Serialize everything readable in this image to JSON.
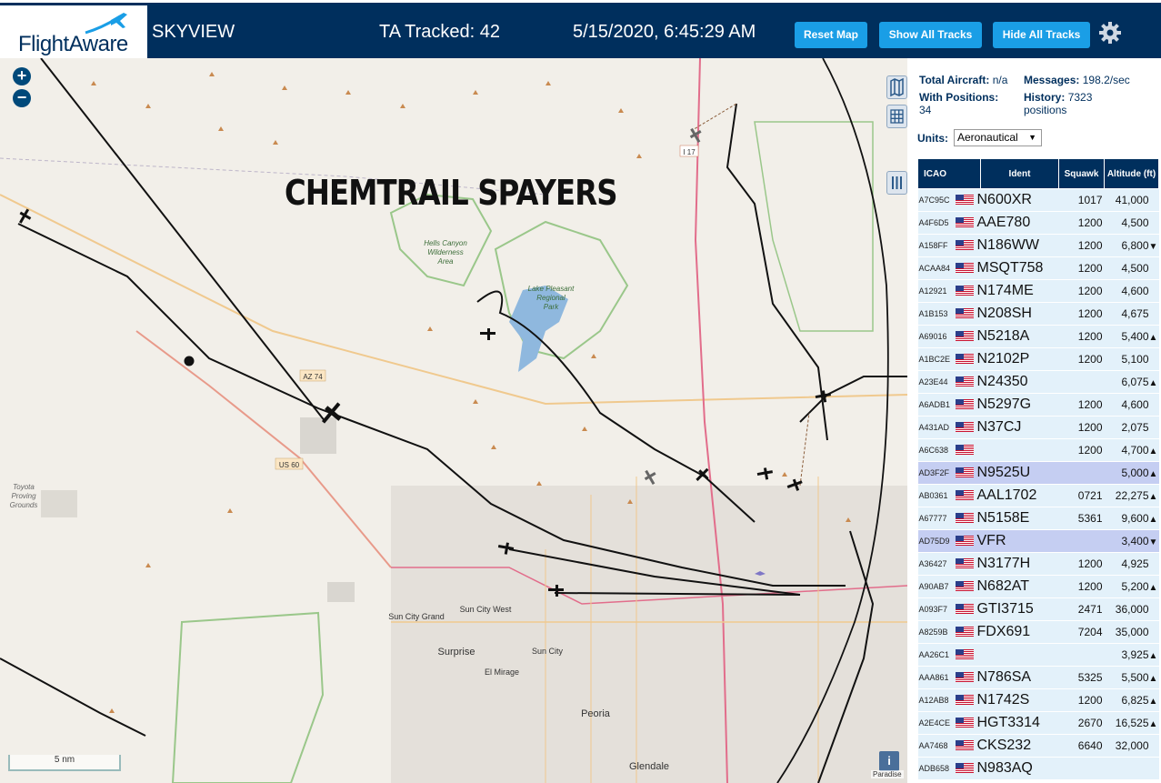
{
  "header": {
    "logo": "FlightAware",
    "title": "SKYVIEW",
    "tracked": "TA Tracked: 42",
    "datetime": "5/15/2020, 6:45:29 AM",
    "buttons": {
      "reset": "Reset Map",
      "show": "Show All Tracks",
      "hide": "Hide All Tracks"
    }
  },
  "map": {
    "overlay_text": "CHEMTRAIL SPAYERS",
    "scale": "5 nm",
    "attribution": "Paradise",
    "labels": {
      "az74": "AZ 74",
      "us60": "US 60",
      "i17": "I 17",
      "hells1": "Hells Canyon",
      "hells2": "Wilderness",
      "hells3": "Area",
      "lake1": "Lake Pleasant",
      "lake2": "Regional",
      "lake3": "Park",
      "toyota1": "Toyota",
      "toyota2": "Proving",
      "toyota3": "Grounds",
      "suncitywest": "Sun City West",
      "suncitygrand": "Sun City Grand",
      "surprise": "Surprise",
      "suncity": "Sun City",
      "elmirage": "El Mirage",
      "peoria": "Peoria",
      "glendale": "Glendale"
    }
  },
  "stats": {
    "total_label": "Total Aircraft:",
    "total_value": "n/a",
    "messages_label": "Messages:",
    "messages_value": "198.2/sec",
    "positions_label": "With Positions:",
    "positions_value": "34",
    "history_label": "History:",
    "history_value": "7323",
    "history_unit": "positions"
  },
  "units": {
    "label": "Units:",
    "selected": "Aeronautical"
  },
  "table": {
    "headers": {
      "icao": "ICAO",
      "ident": "Ident",
      "squawk": "Squawk",
      "altitude": "Altitude (ft)"
    },
    "rows": [
      {
        "icao": "A7C95C",
        "ident": "N600XR",
        "squawk": "1017",
        "alt": "41,000",
        "dir": ""
      },
      {
        "icao": "A4F6D5",
        "ident": "AAE780",
        "squawk": "1200",
        "alt": "4,500",
        "dir": ""
      },
      {
        "icao": "A158FF",
        "ident": "N186WW",
        "squawk": "1200",
        "alt": "6,800",
        "dir": "▼"
      },
      {
        "icao": "ACAA84",
        "ident": "MSQT758",
        "squawk": "1200",
        "alt": "4,500",
        "dir": ""
      },
      {
        "icao": "A12921",
        "ident": "N174ME",
        "squawk": "1200",
        "alt": "4,600",
        "dir": ""
      },
      {
        "icao": "A1B153",
        "ident": "N208SH",
        "squawk": "1200",
        "alt": "4,675",
        "dir": ""
      },
      {
        "icao": "A69016",
        "ident": "N5218A",
        "squawk": "1200",
        "alt": "5,400",
        "dir": "▲"
      },
      {
        "icao": "A1BC2E",
        "ident": "N2102P",
        "squawk": "1200",
        "alt": "5,100",
        "dir": ""
      },
      {
        "icao": "A23E44",
        "ident": "N24350",
        "squawk": "",
        "alt": "6,075",
        "dir": "▲"
      },
      {
        "icao": "A6ADB1",
        "ident": "N5297G",
        "squawk": "1200",
        "alt": "4,600",
        "dir": ""
      },
      {
        "icao": "A431AD",
        "ident": "N37CJ",
        "squawk": "1200",
        "alt": "2,075",
        "dir": ""
      },
      {
        "icao": "A6C638",
        "ident": "",
        "squawk": "1200",
        "alt": "4,700",
        "dir": "▲"
      },
      {
        "icao": "AD3F2F",
        "ident": "N9525U",
        "squawk": "",
        "alt": "5,000",
        "dir": "▲"
      },
      {
        "icao": "AB0361",
        "ident": "AAL1702",
        "squawk": "0721",
        "alt": "22,275",
        "dir": "▲"
      },
      {
        "icao": "A67777",
        "ident": "N5158E",
        "squawk": "5361",
        "alt": "9,600",
        "dir": "▲"
      },
      {
        "icao": "AD75D9",
        "ident": "VFR",
        "squawk": "",
        "alt": "3,400",
        "dir": "▼"
      },
      {
        "icao": "A36427",
        "ident": "N3177H",
        "squawk": "1200",
        "alt": "4,925",
        "dir": ""
      },
      {
        "icao": "A90AB7",
        "ident": "N682AT",
        "squawk": "1200",
        "alt": "5,200",
        "dir": "▲"
      },
      {
        "icao": "A093F7",
        "ident": "GTI3715",
        "squawk": "2471",
        "alt": "36,000",
        "dir": ""
      },
      {
        "icao": "A8259B",
        "ident": "FDX691",
        "squawk": "7204",
        "alt": "35,000",
        "dir": ""
      },
      {
        "icao": "AA26C1",
        "ident": "",
        "squawk": "",
        "alt": "3,925",
        "dir": "▲"
      },
      {
        "icao": "AAA861",
        "ident": "N786SA",
        "squawk": "5325",
        "alt": "5,500",
        "dir": "▲"
      },
      {
        "icao": "A12AB8",
        "ident": "N1742S",
        "squawk": "1200",
        "alt": "6,825",
        "dir": "▲"
      },
      {
        "icao": "A2E4CE",
        "ident": "HGT3314",
        "squawk": "2670",
        "alt": "16,525",
        "dir": "▲"
      },
      {
        "icao": "AA7468",
        "ident": "CKS232",
        "squawk": "6640",
        "alt": "32,000",
        "dir": ""
      },
      {
        "icao": "ADB658",
        "ident": "N983AQ",
        "squawk": "",
        "alt": "",
        "dir": ""
      }
    ]
  },
  "colors": {
    "header": "#002f5d",
    "button": "#1a9ee6",
    "row": "#e3f1fa",
    "row_selected": "#c5cef2"
  },
  "icons": [
    "plus-icon",
    "minus-icon",
    "map-layers-icon",
    "grid-icon",
    "columns-icon",
    "gear-icon",
    "info-icon",
    "airplane-icon",
    "us-flag-icon"
  ]
}
